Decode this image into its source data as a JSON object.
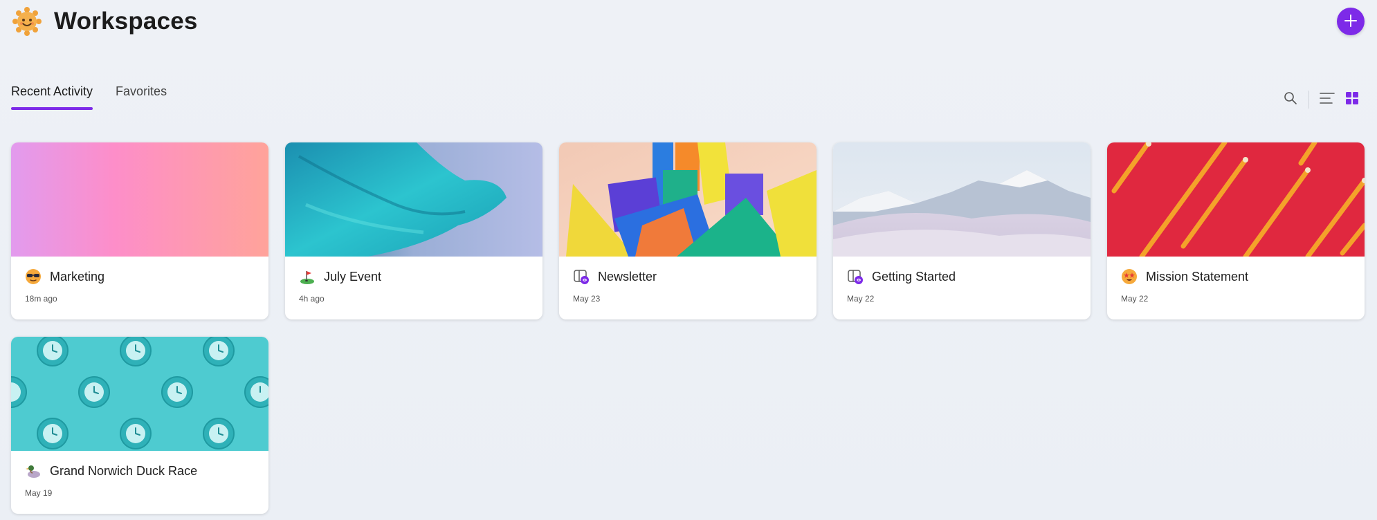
{
  "header": {
    "title": "Workspaces",
    "logo_icon": "sun-face-icon",
    "add_icon": "plus-icon"
  },
  "tabs": [
    {
      "label": "Recent Activity",
      "active": true
    },
    {
      "label": "Favorites",
      "active": false
    }
  ],
  "toolbar": {
    "search_icon": "search-icon",
    "list_icon": "list-view-icon",
    "grid_icon": "grid-view-icon",
    "accent": "#7d2ae8"
  },
  "cards": [
    {
      "name": "Marketing",
      "time": "18m ago",
      "icon": "sunglasses-face-icon",
      "image": "pink-gradient"
    },
    {
      "name": "July Event",
      "time": "4h ago",
      "icon": "golf-flag-icon",
      "image": "teal-fabric"
    },
    {
      "name": "Newsletter",
      "time": "May 23",
      "icon": "loop-page-icon",
      "image": "colorful-shapes"
    },
    {
      "name": "Getting Started",
      "time": "May 22",
      "icon": "loop-page-icon",
      "image": "snowy-mountains"
    },
    {
      "name": "Mission Statement",
      "time": "May 22",
      "icon": "star-struck-face-icon",
      "image": "red-pencils"
    },
    {
      "name": "Grand Norwich Duck Race",
      "time": "May 19",
      "icon": "duck-icon",
      "image": "teal-clocks"
    }
  ]
}
